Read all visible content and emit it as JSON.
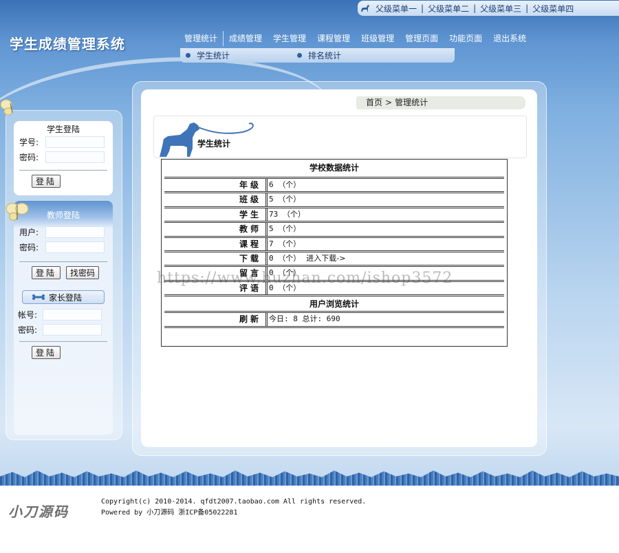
{
  "top_menu": {
    "items": [
      "父级菜单一",
      "父级菜单二",
      "父级菜单三",
      "父级菜单四"
    ],
    "separator": "|"
  },
  "site_title": "学生成绩管理系统",
  "main_nav": {
    "items": [
      "管理统计",
      "成绩管理",
      "学生管理",
      "课程管理",
      "班级管理",
      "管理页面",
      "功能页面",
      "退出系统"
    ],
    "active_index": 0
  },
  "sub_nav": {
    "items": [
      "学生统计",
      "排名统计"
    ]
  },
  "student_login": {
    "title": "学生登陆",
    "id_label": "学号:",
    "password_label": "密码:",
    "id_value": "",
    "password_value": "",
    "login_button": "登陆"
  },
  "teacher_login": {
    "title": "教师登陆",
    "user_label": "用户:",
    "password_label": "密码:",
    "user_value": "",
    "password_value": "",
    "login_button": "登陆",
    "forgot_button": "找密码"
  },
  "parent_login": {
    "tab_label": "家长登陆",
    "account_label": "帐号:",
    "password_label": "密码:",
    "account_value": "",
    "password_value": "",
    "login_button": "登陆"
  },
  "breadcrumb": {
    "home": "首页",
    "separator": ">",
    "current": "管理统计"
  },
  "section_title": "学生统计",
  "stats_table": {
    "header": "学校数据统计",
    "rows": [
      {
        "label": "年级",
        "value": "6 （个）"
      },
      {
        "label": "班级",
        "value": "5 （个）"
      },
      {
        "label": "学生",
        "value": "73 （个）"
      },
      {
        "label": "教师",
        "value": "5 （个）"
      },
      {
        "label": "课程",
        "value": "7 （个）"
      },
      {
        "label": "下载",
        "value": "0 （个）",
        "link": "进入下载->"
      },
      {
        "label": "留言",
        "value": "0 （个）"
      },
      {
        "label": "评语",
        "value": "0 （个）"
      }
    ],
    "browse_header": "用户浏览统计",
    "browse_row": {
      "label": "刷新",
      "value": "今日: 8 总计: 690"
    }
  },
  "watermark": "https://www.huzhan.com/ishop3572",
  "footer": {
    "logo": "小刀源码",
    "copyright": "Copyright(c) 2010-2014. qfdt2007.taobao.com All rights reserved.",
    "powered": "Powered by 小刀源码  浙ICP备05022281"
  },
  "colors": {
    "bg_top": "#3a72b6",
    "bg_mid": "#b8d4ef",
    "nav_text": "#ffffff",
    "table_border": "#333333"
  }
}
